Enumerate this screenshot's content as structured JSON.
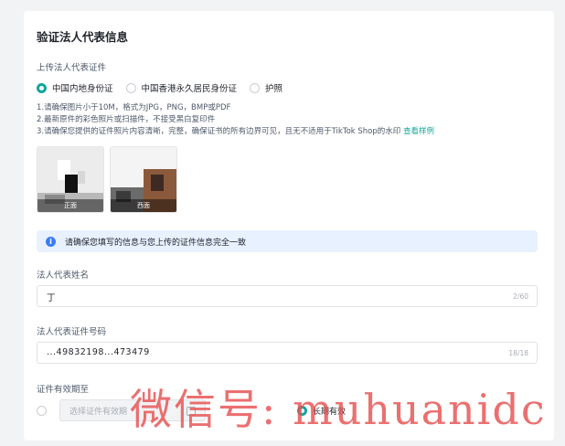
{
  "page": {
    "title": "验证法人代表信息",
    "upload_label": "上传法人代表证件",
    "id_types": [
      {
        "label": "中国内地身份证",
        "selected": true
      },
      {
        "label": "中国香港永久居民身份证",
        "selected": false
      },
      {
        "label": "护照",
        "selected": false
      }
    ],
    "notes": {
      "line1": "1.请确保图片小于10M，格式为JPG，PNG，BMP或PDF",
      "line2": "2.最新原件的彩色照片或扫描件，不接受黑白复印件",
      "line3": "3.请确保您提供的证件照片内容清晰，完整，确保证书的所有边界可见，且无不适用于TikTok Shop的水印",
      "line3_link": "查看样例"
    },
    "thumbnails": [
      {
        "caption": "正面"
      },
      {
        "caption": "西面"
      }
    ],
    "banner": {
      "icon": "info-icon",
      "text": "请确保您填写的信息与您上传的证件信息完全一致"
    },
    "name_field": {
      "label": "法人代表姓名",
      "value": "丁",
      "count": "2/60"
    },
    "id_field": {
      "label": "法人代表证件号码",
      "value": "...49832198...473479",
      "count": "18/18"
    },
    "validity": {
      "label": "证件有效期至",
      "date_placeholder": "选择证件有效期",
      "long_term_label": "长期有效",
      "long_term_selected": true
    },
    "watermark": "微信号: muhuanidc",
    "colors": {
      "accent": "#14a59b",
      "banner_bg": "#e8f1ff",
      "info": "#3b7cf6"
    }
  }
}
